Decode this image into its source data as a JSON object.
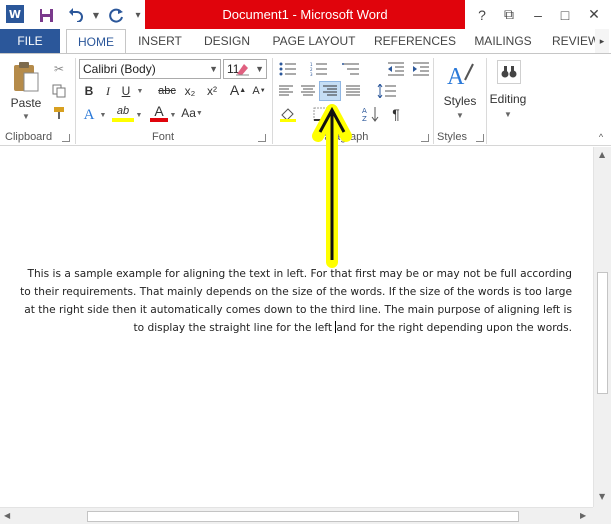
{
  "window": {
    "title": "Document1 - Microsoft Word",
    "help": "?",
    "restore": "⧉",
    "minimize": "–",
    "maximize": "□"
  },
  "tabs": {
    "file": "FILE",
    "home": "HOME",
    "insert": "INSERT",
    "design": "DESIGN",
    "page_layout": "PAGE LAYOUT",
    "references": "REFERENCES",
    "mailings": "MAILINGS",
    "review": "REVIEW"
  },
  "clipboard": {
    "paste": "Paste",
    "label": "Clipboard"
  },
  "font": {
    "name": "Calibri (Body)",
    "size": "11",
    "label": "Font",
    "bold": "B",
    "italic": "I",
    "underline": "U",
    "strike": "abc",
    "subscript": "x₂",
    "superscript": "x²",
    "change_case": "Aa",
    "grow": "A",
    "shrink": "A",
    "text_effects": "A",
    "highlight": "ab",
    "font_color": "A"
  },
  "paragraph": {
    "label": "Paragraph",
    "pilcrow": "¶"
  },
  "styles": {
    "label": "Styles",
    "button": "Styles"
  },
  "editing": {
    "button": "Editing"
  },
  "document": {
    "text_before_cursor": "This is a sample example for aligning the text in left. For that first may be or may not be full according to their requirements. That mainly depends on the size of the words. If the size of the words is too large at the right side then it automatically comes down to the third line. The main purpose of aligning left is to display the straight line for the left ",
    "text_after_cursor": "and for the right depending upon the words."
  },
  "colors": {
    "title_red": "#e0040c",
    "file_blue": "#2b579a",
    "highlight_yellow": "#ffff00",
    "selected_button": "#c5def5"
  }
}
